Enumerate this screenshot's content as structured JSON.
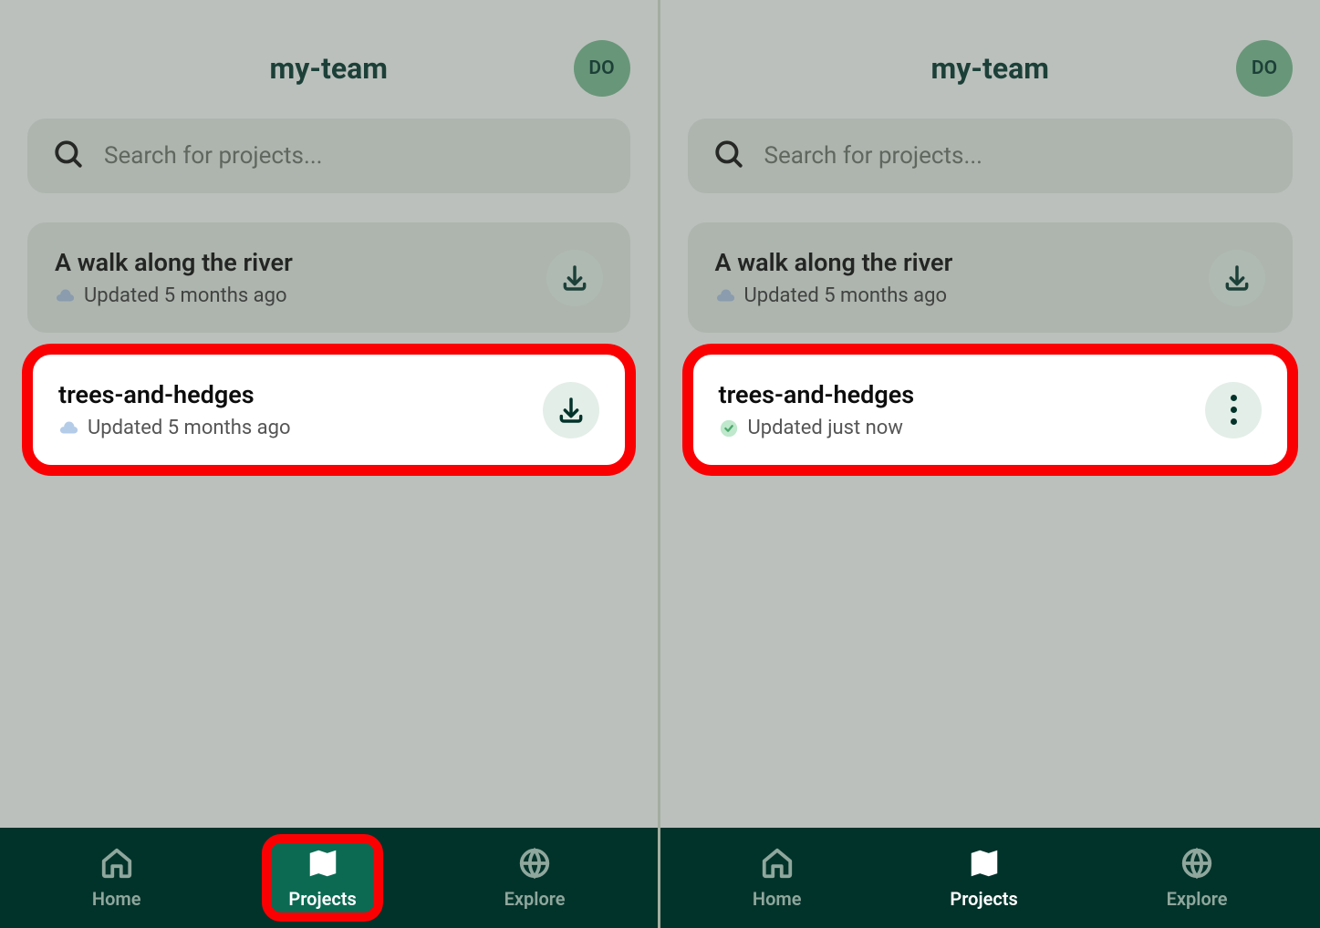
{
  "header": {
    "team_name": "my-team",
    "avatar_initials": "DO"
  },
  "search": {
    "placeholder": "Search for projects..."
  },
  "left_pane": {
    "projects": [
      {
        "title": "A walk along the river",
        "updated": "Updated 5 months ago",
        "status": "cloud",
        "action": "download"
      },
      {
        "title": "trees-and-hedges",
        "updated": "Updated 5 months ago",
        "status": "cloud",
        "action": "download",
        "highlighted": true
      }
    ]
  },
  "right_pane": {
    "projects": [
      {
        "title": "A walk along the river",
        "updated": "Updated 5 months ago",
        "status": "cloud",
        "action": "download"
      },
      {
        "title": "trees-and-hedges",
        "updated": "Updated just now",
        "status": "synced",
        "action": "menu",
        "highlighted": true
      }
    ]
  },
  "nav": {
    "home": "Home",
    "projects": "Projects",
    "explore": "Explore"
  }
}
